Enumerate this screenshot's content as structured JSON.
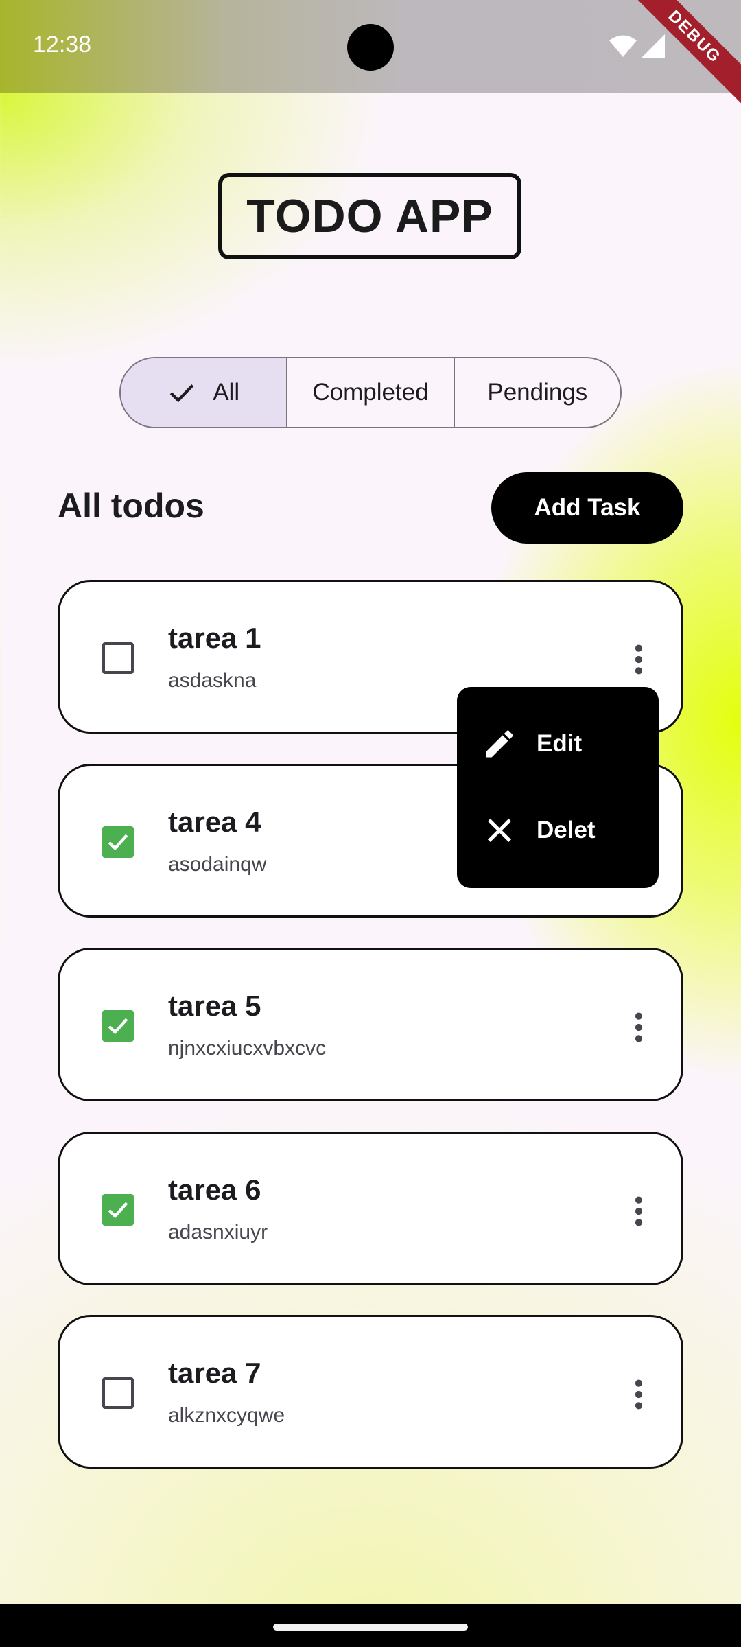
{
  "status_bar": {
    "time": "12:38",
    "debug_label": "DEBUG"
  },
  "app": {
    "title": "TODO APP"
  },
  "filters": {
    "items": [
      "All",
      "Completed",
      "Pendings"
    ],
    "selected": "All"
  },
  "section": {
    "title": "All todos",
    "add_button_label": "Add Task"
  },
  "todos": [
    {
      "title": "tarea 1",
      "description": "asdaskna",
      "completed": false
    },
    {
      "title": "tarea 4",
      "description": "asodainqw",
      "completed": true
    },
    {
      "title": "tarea 5",
      "description": "njnxcxiucxvbxcvc",
      "completed": true
    },
    {
      "title": "tarea 6",
      "description": "adasnxiuyr",
      "completed": true
    },
    {
      "title": "tarea 7",
      "description": "alkznxcyqwe",
      "completed": false
    }
  ],
  "popup_menu": {
    "edit_label": "Edit",
    "delete_label": "Delet"
  },
  "colors": {
    "checked": "#4caf50",
    "selected_segment": "#e6dff2",
    "accent_bg": "#e2ff00"
  },
  "icons": [
    "wifi-icon",
    "signal-icon",
    "check-icon",
    "more-vert-icon",
    "edit-pencil-icon",
    "close-icon"
  ]
}
